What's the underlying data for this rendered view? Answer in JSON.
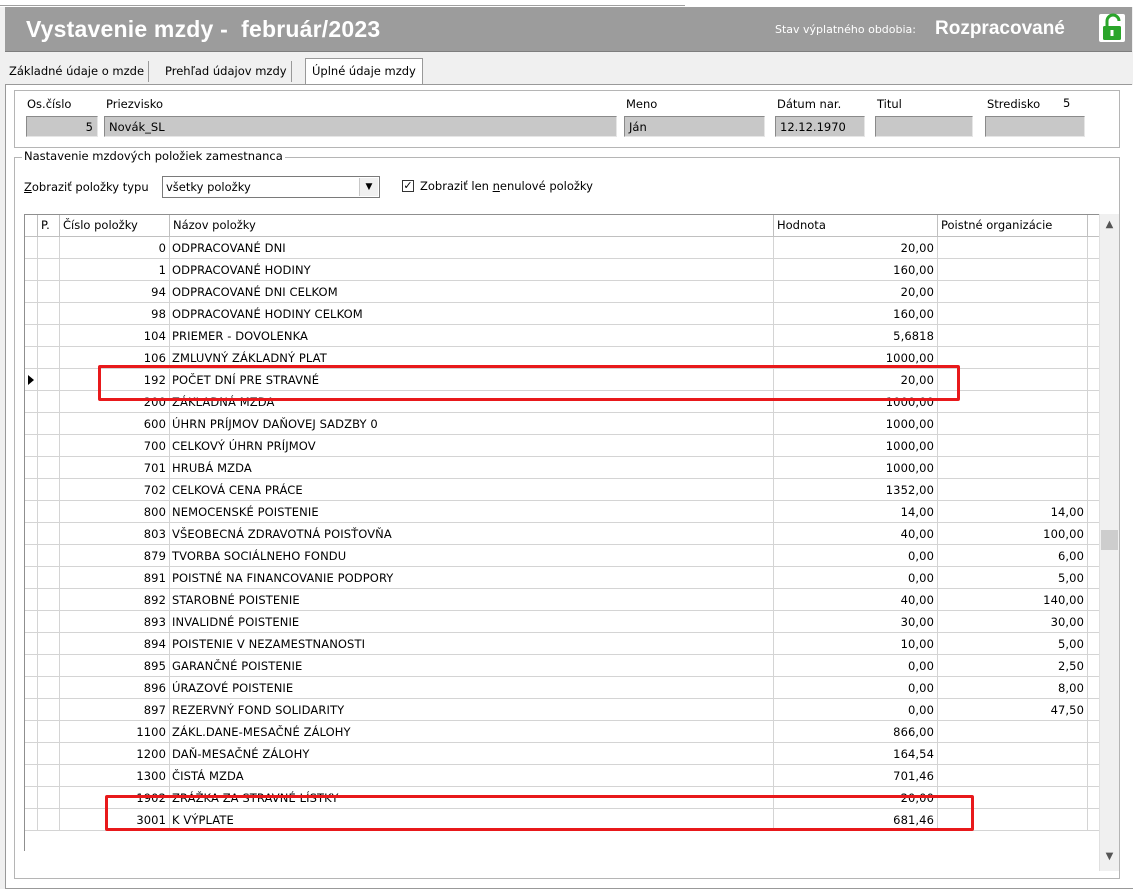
{
  "window": {
    "title": "Vystavenie mzdy -  február/2023",
    "status_label": "Stav výplatného obdobia:",
    "status_value": "Rozpracované",
    "lock_icon": "unlocked-padlock-icon",
    "accent": "#2aa52a"
  },
  "tabs": [
    {
      "label": "Základné údaje o mzde"
    },
    {
      "label": "Prehľad údajov mzdy"
    },
    {
      "label": "Úplné údaje mzdy",
      "active": true
    }
  ],
  "employee": {
    "os_cislo_label": "Os.číslo",
    "os_cislo": "5",
    "priezvisko_label": "Priezvisko",
    "priezvisko": "Novák_SL",
    "meno_label": "Meno",
    "meno": "Ján",
    "datum_label": "Dátum nar.",
    "datum": "12.12.1970",
    "titul_label": "Titul",
    "titul": "",
    "stredisko_label": "Stredisko",
    "stredisko": "5"
  },
  "settings": {
    "group_title": "Nastavenie mzdových položiek zamestnanca",
    "filter_label_prefix": "Z",
    "filter_label_rest": "obraziť položky typu",
    "filter_value": "všetky položky",
    "nonzero_checked": true,
    "nonzero_prefix": "Zobraziť len ",
    "nonzero_u": "n",
    "nonzero_rest": "enulové položky"
  },
  "grid": {
    "headers": {
      "p": "P.",
      "num": "Číslo položky",
      "name": "Názov položky",
      "value": "Hodnota",
      "org": "Poistné organizácie"
    },
    "current_row": 6,
    "rows": [
      {
        "num": "0",
        "name": "ODPRACOVANÉ DNI",
        "value": "20,00",
        "org": ""
      },
      {
        "num": "1",
        "name": "ODPRACOVANÉ HODINY",
        "value": "160,00",
        "org": ""
      },
      {
        "num": "94",
        "name": "ODPRACOVANÉ DNI CELKOM",
        "value": "20,00",
        "org": ""
      },
      {
        "num": "98",
        "name": "ODPRACOVANÉ HODINY CELKOM",
        "value": "160,00",
        "org": ""
      },
      {
        "num": "104",
        "name": "PRIEMER - DOVOLENKA",
        "value": "5,6818",
        "org": ""
      },
      {
        "num": "106",
        "name": "ZMLUVNÝ ZÁKLADNÝ PLAT",
        "value": "1000,00",
        "org": ""
      },
      {
        "num": "192",
        "name": "POČET DNÍ PRE STRAVNÉ",
        "value": "20,00",
        "org": ""
      },
      {
        "num": "200",
        "name": "ZÁKLADNÁ MZDA",
        "value": "1000,00",
        "org": ""
      },
      {
        "num": "600",
        "name": "ÚHRN PRÍJMOV DAŇOVEJ SADZBY 0",
        "value": "1000,00",
        "org": ""
      },
      {
        "num": "700",
        "name": "CELKOVÝ ÚHRN PRÍJMOV",
        "value": "1000,00",
        "org": ""
      },
      {
        "num": "701",
        "name": "HRUBÁ MZDA",
        "value": "1000,00",
        "org": ""
      },
      {
        "num": "702",
        "name": "CELKOVÁ CENA PRÁCE",
        "value": "1352,00",
        "org": ""
      },
      {
        "num": "800",
        "name": "NEMOCENSKÉ POISTENIE",
        "value": "14,00",
        "org": "14,00"
      },
      {
        "num": "803",
        "name": "VŠEOBECNÁ ZDRAVOTNÁ POISŤOVŇA",
        "value": "40,00",
        "org": "100,00"
      },
      {
        "num": "879",
        "name": "TVORBA SOCIÁLNEHO FONDU",
        "value": "0,00",
        "org": "6,00"
      },
      {
        "num": "891",
        "name": "POISTNÉ NA FINANCOVANIE PODPORY",
        "value": "0,00",
        "org": "5,00"
      },
      {
        "num": "892",
        "name": "STAROBNÉ POISTENIE",
        "value": "40,00",
        "org": "140,00"
      },
      {
        "num": "893",
        "name": "INVALIDNÉ POISTENIE",
        "value": "30,00",
        "org": "30,00"
      },
      {
        "num": "894",
        "name": "POISTENIE V NEZAMESTNANOSTI",
        "value": "10,00",
        "org": "5,00"
      },
      {
        "num": "895",
        "name": "GARANČNÉ POISTENIE",
        "value": "0,00",
        "org": "2,50"
      },
      {
        "num": "896",
        "name": "ÚRAZOVÉ POISTENIE",
        "value": "0,00",
        "org": "8,00"
      },
      {
        "num": "897",
        "name": "REZERVNÝ FOND SOLIDARITY",
        "value": "0,00",
        "org": "47,50"
      },
      {
        "num": "1100",
        "name": "ZÁKL.DANE-MESAČNÉ ZÁLOHY",
        "value": "866,00",
        "org": ""
      },
      {
        "num": "1200",
        "name": "DAŇ-MESAČNÉ ZÁLOHY",
        "value": "164,54",
        "org": ""
      },
      {
        "num": "1300",
        "name": "ČISTÁ MZDA",
        "value": "701,46",
        "org": ""
      },
      {
        "num": "1902",
        "name": "ZRÁŽKA ZA STRAVNÉ LÍSTKY",
        "value": "20,00",
        "org": ""
      },
      {
        "num": "3001",
        "name": "K VÝPLATE",
        "value": "681,46",
        "org": ""
      }
    ],
    "highlight_color": "#e8191b"
  }
}
